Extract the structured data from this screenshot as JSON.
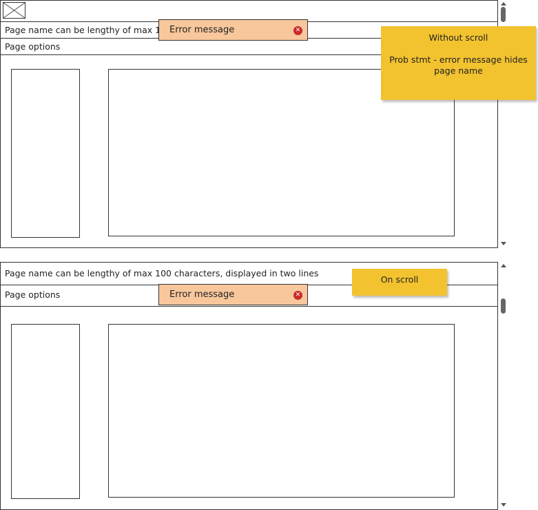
{
  "top_window": {
    "page_name": "Page name can be lengthy of max 100",
    "page_options": "Page options",
    "error": {
      "message": "Error message",
      "close_glyph": "✕"
    }
  },
  "bottom_window": {
    "page_name": "Page name can be lengthy of max 100 characters, displayed in two lines",
    "page_options": "Page options",
    "error": {
      "message": "Error message",
      "close_glyph": "✕"
    }
  },
  "notes": {
    "without_scroll": {
      "title": "Without scroll",
      "line1": "Prob stmt - error message hides",
      "line2": "page name"
    },
    "on_scroll": {
      "title": "On scroll"
    }
  },
  "colors": {
    "error_bg": "#f8c79b",
    "sticky_bg": "#f2c22f",
    "error_icon": "#cc2a2a"
  }
}
